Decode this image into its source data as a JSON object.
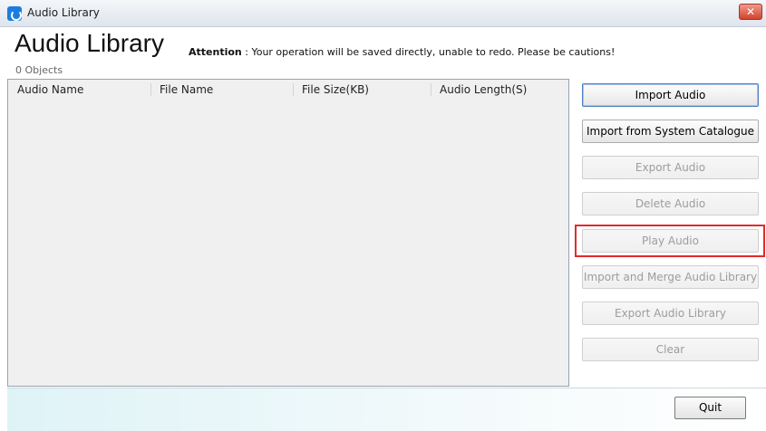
{
  "window": {
    "title": "Audio Library",
    "close_glyph": "✕"
  },
  "header": {
    "heading": "Audio Library",
    "attention_label": "Attention",
    "attention_text": " : Your operation will be saved directly, unable to redo. Please be cautions!",
    "object_count": "0 Objects"
  },
  "table": {
    "columns": [
      "Audio Name",
      "File Name",
      "File Size(KB)",
      "Audio Length(S)"
    ],
    "rows": []
  },
  "actions": {
    "import_audio": "Import Audio",
    "import_system": "Import from System Catalogue",
    "export_audio": "Export Audio",
    "delete_audio": "Delete Audio",
    "play_audio": "Play Audio",
    "import_merge": "Import and Merge Audio Library",
    "export_library": "Export Audio Library",
    "clear": "Clear"
  },
  "footer": {
    "quit": "Quit"
  },
  "colors": {
    "highlight": "#e12b2b",
    "accent": "#1a7de0"
  }
}
